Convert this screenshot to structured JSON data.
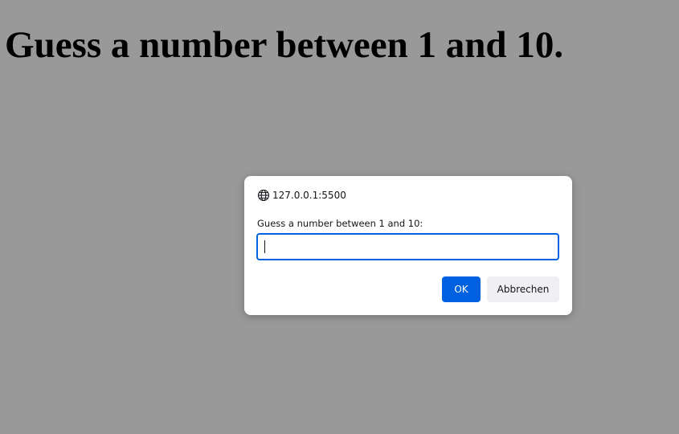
{
  "page": {
    "heading": "Guess a number between 1 and 10."
  },
  "dialog": {
    "origin": "127.0.0.1:5500",
    "origin_icon": "globe-icon",
    "message": "Guess a number between 1 and 10:",
    "input_value": "",
    "ok_label": "OK",
    "cancel_label": "Abbrechen"
  },
  "colors": {
    "accent": "#0061e0",
    "overlay": "rgba(0,0,0,0.4)",
    "secondary_button": "#f0f0f4"
  }
}
